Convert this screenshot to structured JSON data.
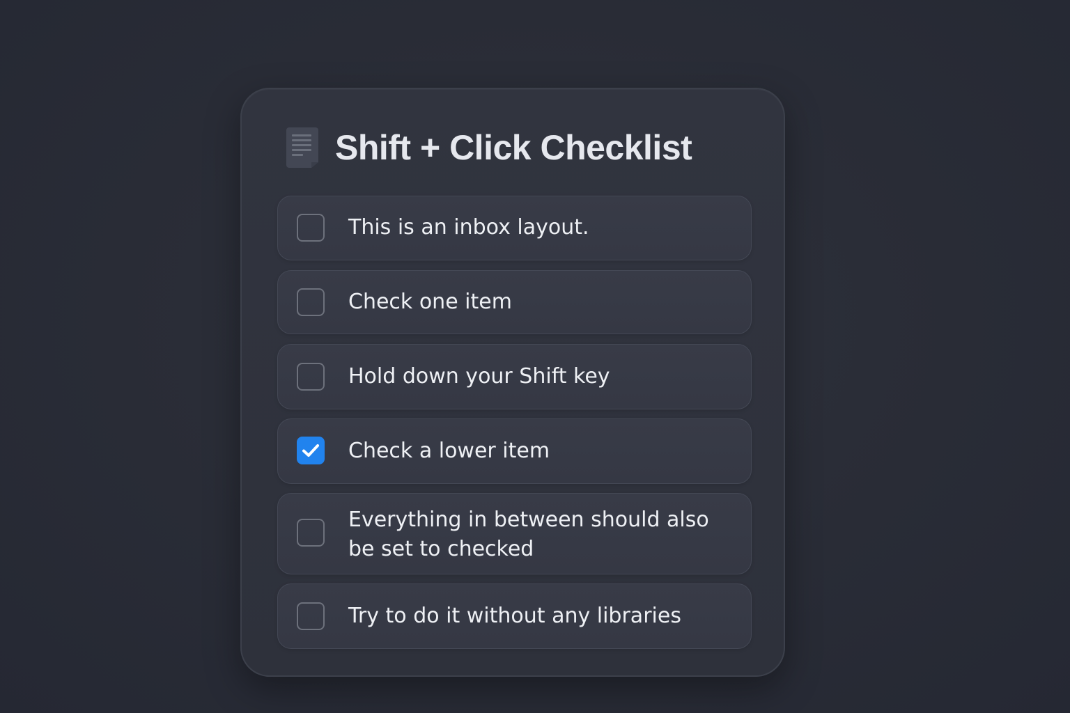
{
  "page": {
    "title": "Shift + Click Checklist",
    "title_icon": "document-icon"
  },
  "checklist": {
    "items": [
      {
        "label": "This is an inbox layout.",
        "checked": false
      },
      {
        "label": "Check one item",
        "checked": false
      },
      {
        "label": "Hold down your Shift key",
        "checked": false
      },
      {
        "label": "Check a lower item",
        "checked": true
      },
      {
        "label": "Everything in between should also be set to checked",
        "checked": false
      },
      {
        "label": "Try to do it without any libraries",
        "checked": false
      }
    ]
  },
  "colors": {
    "background": "#2a2d37",
    "card": "#30333e",
    "item": "#373a46",
    "accent": "#2183ee",
    "text": "#eef0f4"
  }
}
